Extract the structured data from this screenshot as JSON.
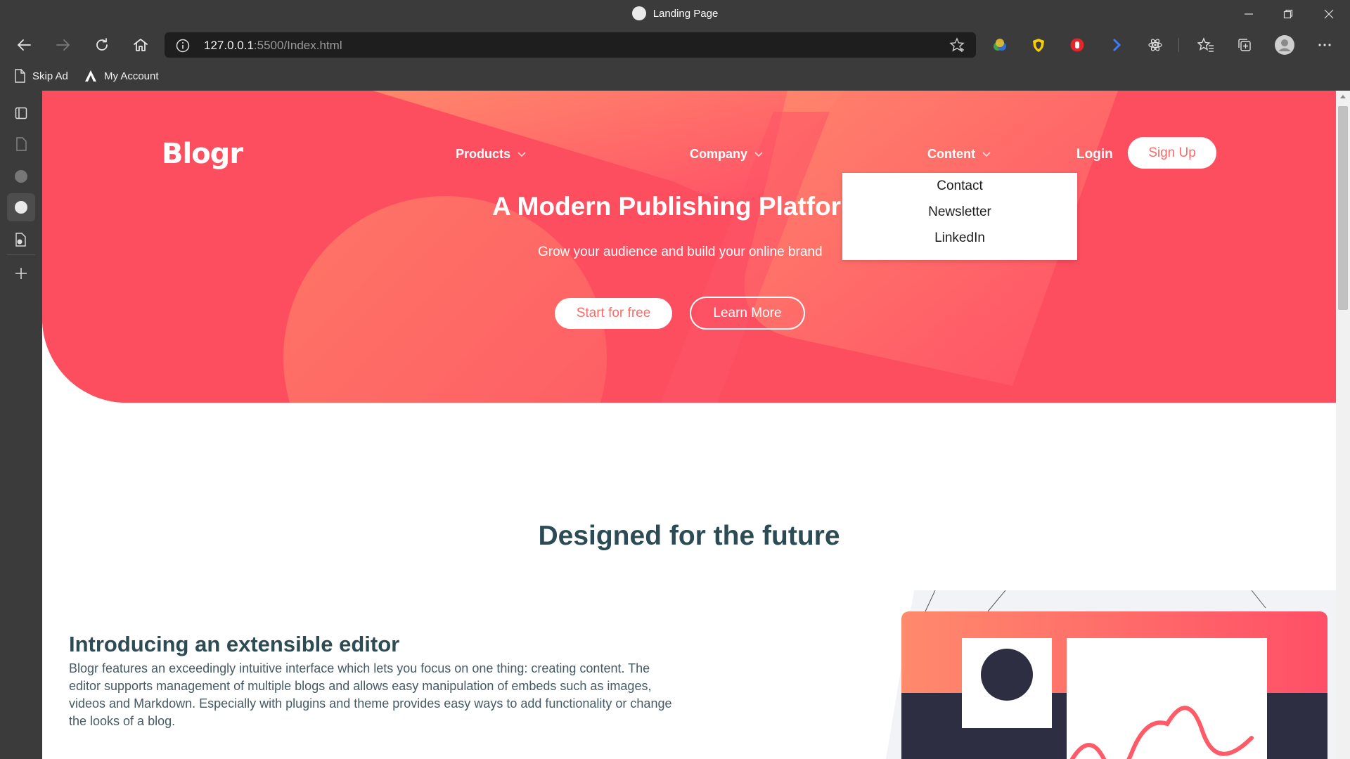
{
  "browser": {
    "tab_title": "Landing Page",
    "url_host": "127.0.0.1",
    "url_rest": ":5500/Index.html",
    "favorites": [
      {
        "label": "Skip Ad"
      },
      {
        "label": "My Account"
      }
    ]
  },
  "page": {
    "logo": "Blogr",
    "nav": {
      "products": "Products",
      "company": "Company",
      "content": "Content",
      "login": "Login",
      "signup": "Sign Up"
    },
    "dropdown": [
      "Contact",
      "Newsletter",
      "LinkedIn"
    ],
    "hero": {
      "title": "A Modern Publishing Platform",
      "subtitle": "Grow your audience and build your online brand",
      "start_button": "Start for free",
      "learn_button": "Learn More"
    },
    "section_title": "Designed for the future",
    "feature": {
      "title": "Introducing an extensible editor",
      "text": "Blogr features an exceedingly intuitive interface which lets you focus on one thing: creating content. The editor supports management of multiple blogs and allows easy manipulation of embeds such as images, videos and Markdown. Especially with plugins and theme provides easy ways to add functionality or change the looks of a blog."
    }
  },
  "colors": {
    "hero_red": "#fc4e5f",
    "accent_coral": "#ff6a6a",
    "heading_dark": "#2c4b55",
    "chrome_bg": "#3b3b3b"
  }
}
